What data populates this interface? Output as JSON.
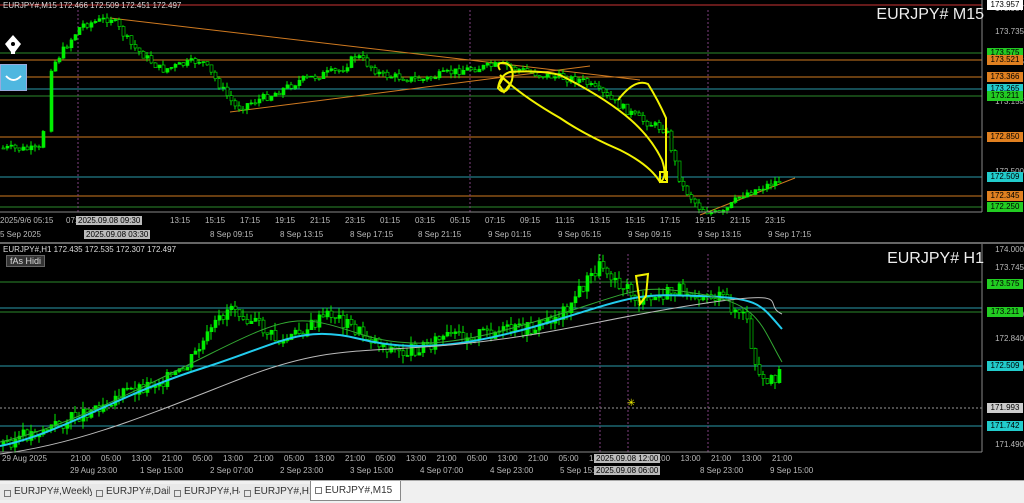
{
  "colors": {
    "bg": "#000000",
    "bull": "#00ee00",
    "ma_cyan": "#22ccee",
    "ma_white": "#bbbbbb",
    "ma_green": "#33aa33",
    "orange": "#d07a20",
    "annot": "#f2f200",
    "green_line": "#2d8a2d",
    "cyan_line": "#2a9aaa"
  },
  "top": {
    "info": "EURJPY#,M15  172.466 172.509 172.451 172.497",
    "symbol": "EURJPY# M15",
    "price_ticks": [
      "173.957",
      "173.735",
      "173.465",
      "173.155",
      "172.500"
    ],
    "price_tags": [
      {
        "label": "173.957",
        "bg": "#ffffff",
        "fg": "#000"
      },
      {
        "label": "173.575",
        "bg": "#22cc22",
        "fg": "#000"
      },
      {
        "label": "173.521",
        "bg": "#e08020",
        "fg": "#000"
      },
      {
        "label": "173.366",
        "bg": "#e08020",
        "fg": "#000"
      },
      {
        "label": "173.265",
        "bg": "#22cccc",
        "fg": "#000"
      },
      {
        "label": "173.211",
        "bg": "#22cc22",
        "fg": "#000"
      },
      {
        "label": "172.850",
        "bg": "#e08020",
        "fg": "#000"
      },
      {
        "label": "172.509",
        "bg": "#22cccc",
        "fg": "#000"
      },
      {
        "label": "172.345",
        "bg": "#e08020",
        "fg": "#000"
      },
      {
        "label": "172.250",
        "bg": "#22cc22",
        "fg": "#000"
      }
    ],
    "time_labels": [
      "2025/9/6 05:15",
      "07:15",
      "8 Sep 05:15",
      "13:15",
      "15:15",
      "17:15",
      "19:15",
      "21:15",
      "23:15",
      "01:15",
      "03:15",
      "05:15",
      "07:15",
      "09:15",
      "11:15",
      "13:15",
      "15:15",
      "17:15",
      "19:15",
      "21:15",
      "23:15"
    ],
    "date_labels": [
      "5 Sep 2025",
      "8 Sep 09:15",
      "8 Sep 13:15",
      "8 Sep 17:15",
      "8 Sep 21:15",
      "9 Sep 01:15",
      "9 Sep 05:15",
      "9 Sep 09:15",
      "9 Sep 13:15",
      "9 Sep 17:15"
    ],
    "crosshair_time_1": "2025.09.08 09:30",
    "crosshair_time_2": "2025.09.08 03:30"
  },
  "bottom": {
    "info": "EURJPY#,H1  172.435 172.535 172.307 172.497",
    "symbol": "EURJPY# H1",
    "hide_label": "fAs Hidi",
    "price_ticks": [
      "174.000",
      "173.745",
      "173.290",
      "172.840",
      "172.390",
      "171.490"
    ],
    "price_tags": [
      {
        "label": "173.575",
        "bg": "#22cc22",
        "fg": "#000"
      },
      {
        "label": "173.211",
        "bg": "#22cc22",
        "fg": "#000"
      },
      {
        "label": "172.509",
        "bg": "#22cccc",
        "fg": "#000"
      },
      {
        "label": "171.993",
        "bg": "#cccccc",
        "fg": "#000"
      },
      {
        "label": "171.742",
        "bg": "#22cccc",
        "fg": "#000"
      }
    ],
    "time_labels": [
      "29 Aug 2025",
      "21:00",
      "05:00",
      "13:00",
      "21:00",
      "05:00",
      "13:00",
      "21:00",
      "05:00",
      "13:00",
      "21:00",
      "05:00",
      "13:00",
      "21:00",
      "05:00",
      "13:00",
      "21:00",
      "05:00",
      "13:00",
      "21:00",
      "05:00",
      "13:00",
      "21:00",
      "13:00",
      "21:00"
    ],
    "date_labels": [
      "29 Aug 23:00",
      "1 Sep 15:00",
      "2 Sep 07:00",
      "2 Sep 23:00",
      "3 Sep 15:00",
      "4 Sep 07:00",
      "4 Sep 23:00",
      "5 Sep 15:00",
      "8 Sep 23:00",
      "9 Sep 15:00"
    ],
    "crosshair_time_1": "2025.09.08 12:00",
    "crosshair_time_2": "2025.09.08 06:00"
  },
  "tabs": [
    {
      "label": "EURJPY#,Weekly",
      "active": false
    },
    {
      "label": "EURJPY#,Daily",
      "active": false
    },
    {
      "label": "EURJPY#,H4",
      "active": false
    },
    {
      "label": "EURJPY#,H1",
      "active": false
    },
    {
      "label": "EURJPY#,M15",
      "active": true
    }
  ]
}
